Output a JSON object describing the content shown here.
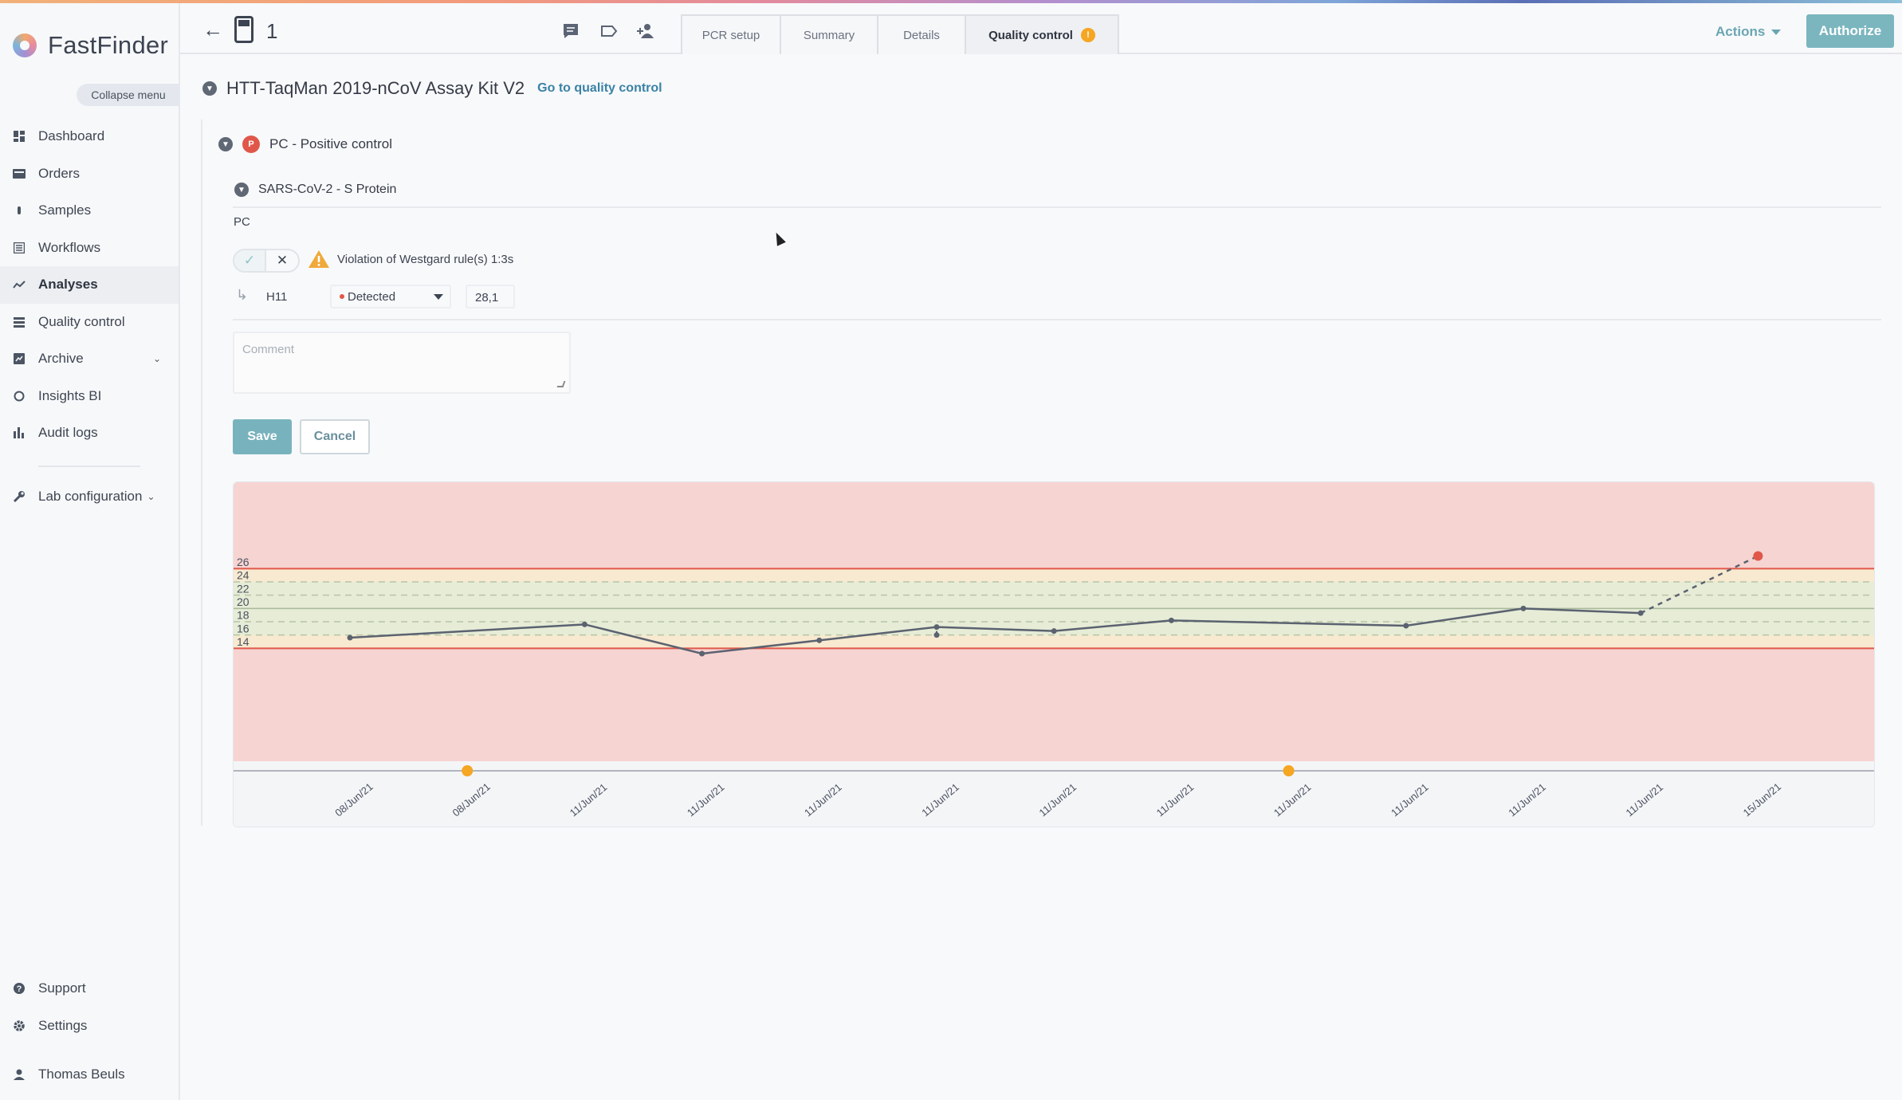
{
  "app": {
    "name": "FastFinder",
    "collapse_label": "Collapse menu"
  },
  "sidebar": {
    "items": [
      {
        "label": "Dashboard",
        "icon": "dashboard-icon",
        "active": false
      },
      {
        "label": "Orders",
        "icon": "orders-icon",
        "active": false
      },
      {
        "label": "Samples",
        "icon": "samples-icon",
        "active": false
      },
      {
        "label": "Workflows",
        "icon": "workflows-icon",
        "active": false
      },
      {
        "label": "Analyses",
        "icon": "analyses-icon",
        "active": true
      },
      {
        "label": "Quality control",
        "icon": "quality-control-icon",
        "active": false
      },
      {
        "label": "Archive",
        "icon": "archive-icon",
        "active": false
      },
      {
        "label": "Insights BI",
        "icon": "insights-icon",
        "active": false
      },
      {
        "label": "Audit logs",
        "icon": "audit-logs-icon",
        "active": false
      }
    ],
    "lab_config": "Lab configuration",
    "support": "Support",
    "settings": "Settings",
    "user": "Thomas Beuls"
  },
  "topbar": {
    "doc_number": "1",
    "tabs": [
      {
        "label": "PCR setup",
        "active": false
      },
      {
        "label": "Summary",
        "active": false
      },
      {
        "label": "Details",
        "active": false
      },
      {
        "label": "Quality control",
        "active": true,
        "badge": "!"
      }
    ],
    "actions_label": "Actions",
    "authorize_label": "Authorize"
  },
  "content": {
    "assay_title": "HTT-TaqMan 2019-nCoV Assay Kit V2",
    "go_to_qc": "Go to quality control",
    "control_badge": "P",
    "control_label": "PC - Positive control",
    "target_label": "SARS-CoV-2 - S Protein",
    "pc_label": "PC",
    "violation_text": "Violation of Westgard rule(s) 1:3s",
    "well": "H11",
    "result_value": "Detected",
    "ct_value": "28,1",
    "comment_placeholder": "Comment",
    "save_label": "Save",
    "cancel_label": "Cancel"
  },
  "colors": {
    "accent": "#78b3bd",
    "link": "#3a82a6",
    "danger": "#e0574a",
    "warning": "#f5a623",
    "chart_red_zone": "#f6d4d2",
    "chart_yellow_zone": "#f7ead0",
    "chart_green_zone": "#e6ecd6"
  },
  "chart_data": {
    "type": "line",
    "x": [
      "08/Jun/21",
      "08/Jun/21",
      "11/Jun/21",
      "11/Jun/21",
      "11/Jun/21",
      "11/Jun/21",
      "11/Jun/21",
      "11/Jun/21",
      "11/Jun/21",
      "11/Jun/21",
      "11/Jun/21",
      "11/Jun/21",
      "15/Jun/21"
    ],
    "values": [
      14.6,
      16.6,
      12.2,
      14.2,
      16.2,
      15.6,
      17.2,
      16.4,
      19.0,
      18.3,
      26.9
    ],
    "point_x_index": [
      0,
      2,
      3,
      4,
      5,
      6,
      7,
      9,
      10,
      11,
      12
    ],
    "yticks": [
      14,
      16,
      18,
      20,
      22,
      24,
      26
    ],
    "ylim": [
      -4,
      38
    ],
    "mean": 19,
    "sd1": [
      17,
      21
    ],
    "sd2": [
      15,
      23
    ],
    "sd3": [
      13,
      25
    ],
    "control_limits": [
      13,
      25
    ],
    "violation_point_index": 10,
    "event_markers_x_index": [
      1,
      8
    ],
    "grid": false
  }
}
